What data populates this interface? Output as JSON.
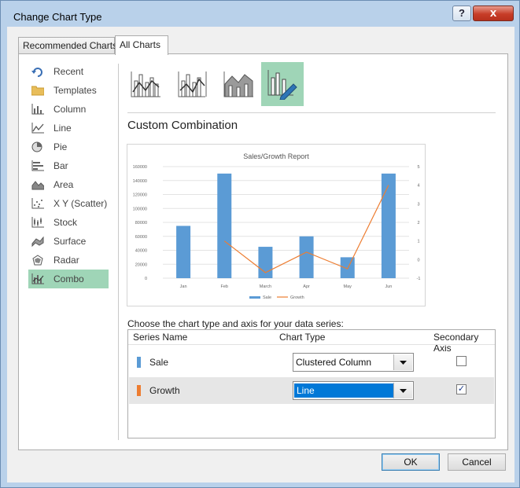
{
  "window": {
    "title": "Change Chart Type",
    "help_glyph": "?",
    "close_glyph": "x"
  },
  "tabs": [
    {
      "label": "Recommended Charts",
      "active": false
    },
    {
      "label": "All Charts",
      "active": true
    }
  ],
  "sidebar": {
    "items": [
      {
        "label": "Recent",
        "icon": "recent-icon",
        "selected": false
      },
      {
        "label": "Templates",
        "icon": "folder-icon",
        "selected": false
      },
      {
        "label": "Column",
        "icon": "column-chart-icon",
        "selected": false
      },
      {
        "label": "Line",
        "icon": "line-chart-icon",
        "selected": false
      },
      {
        "label": "Pie",
        "icon": "pie-chart-icon",
        "selected": false
      },
      {
        "label": "Bar",
        "icon": "bar-chart-icon",
        "selected": false
      },
      {
        "label": "Area",
        "icon": "area-chart-icon",
        "selected": false
      },
      {
        "label": "X Y (Scatter)",
        "icon": "scatter-chart-icon",
        "selected": false
      },
      {
        "label": "Stock",
        "icon": "stock-chart-icon",
        "selected": false
      },
      {
        "label": "Surface",
        "icon": "surface-chart-icon",
        "selected": false
      },
      {
        "label": "Radar",
        "icon": "radar-chart-icon",
        "selected": false
      },
      {
        "label": "Combo",
        "icon": "combo-chart-icon",
        "selected": true
      }
    ]
  },
  "main": {
    "section_title": "Custom Combination",
    "choose_label": "Choose the chart type and axis for your data series:",
    "columns": {
      "series_name": "Series Name",
      "chart_type": "Chart Type",
      "secondary_axis": "Secondary Axis"
    },
    "series": [
      {
        "name": "Sale",
        "color": "#5b9bd5",
        "chart_type": "Clustered Column",
        "secondary": false,
        "focused": false
      },
      {
        "name": "Growth",
        "color": "#ed7d31",
        "chart_type": "Line",
        "secondary": true,
        "focused": true
      }
    ]
  },
  "footer": {
    "ok_label": "OK",
    "cancel_label": "Cancel"
  },
  "colors": {
    "selected": "#9fd5b7",
    "sale": "#5b9bd5",
    "growth": "#ed7d31",
    "focus": "#0078d7"
  },
  "chart_data": {
    "type": "bar",
    "title": "Sales/Growth Report",
    "categories": [
      "Jan",
      "Feb",
      "March",
      "Apr",
      "May",
      "Jun"
    ],
    "series": [
      {
        "name": "Sale",
        "kind": "bar",
        "axis": "primary",
        "values": [
          75000,
          150000,
          45000,
          60000,
          30000,
          150000
        ]
      },
      {
        "name": "Growth",
        "kind": "line",
        "axis": "secondary",
        "values": [
          null,
          1,
          -0.7,
          0.4,
          -0.5,
          4
        ]
      }
    ],
    "y_ticks": [
      "160000",
      "140000",
      "120000",
      "100000",
      "80000",
      "60000",
      "40000",
      "20000",
      "0"
    ],
    "y2_ticks": [
      "5",
      "4",
      "3",
      "2",
      "1",
      "0",
      "-1"
    ],
    "ylim": [
      0,
      160000
    ],
    "y2lim": [
      -1,
      5
    ],
    "legend": [
      "Sale",
      "Growth"
    ],
    "legend_position": "bottom",
    "grid": true
  }
}
